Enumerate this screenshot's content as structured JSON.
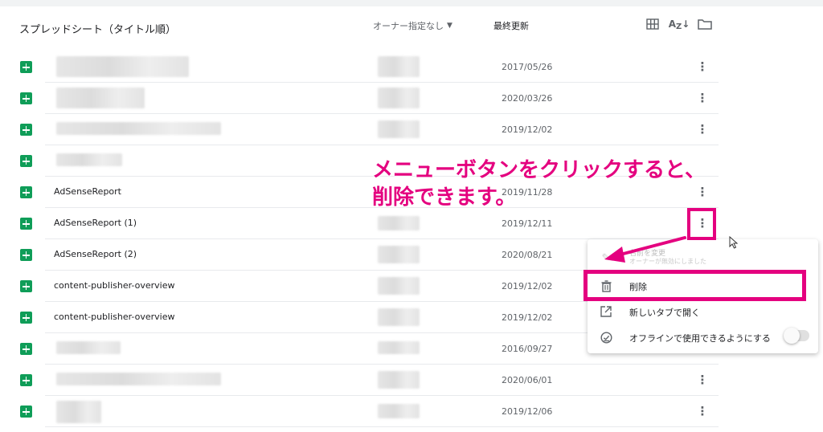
{
  "header": {
    "title": "スプレッドシート（タイトル順）",
    "owner_filter": "オーナー指定なし",
    "last_modified": "最終更新"
  },
  "icons": {
    "grid_view": "grid-icon",
    "sort": "sort-az-icon",
    "folder": "folder-icon"
  },
  "rows": [
    {
      "name": "",
      "date": "2017/05/26"
    },
    {
      "name": "",
      "date": "2020/03/26"
    },
    {
      "name": "",
      "date": "2019/12/02"
    },
    {
      "name": "",
      "date": ""
    },
    {
      "name": "AdSenseReport",
      "date": "2019/11/28"
    },
    {
      "name": "AdSenseReport (1)",
      "date": "2019/12/11"
    },
    {
      "name": "AdSenseReport (2)",
      "date": "2020/08/21"
    },
    {
      "name": "content-publisher-overview",
      "date": "2019/12/02"
    },
    {
      "name": "content-publisher-overview",
      "date": "2019/12/02"
    },
    {
      "name": "",
      "date": "2016/09/27"
    },
    {
      "name": "",
      "date": "2020/06/01"
    },
    {
      "name": "",
      "date": "2019/12/06"
    }
  ],
  "menu": {
    "rename_label": "名前を変更",
    "rename_sub": "オーナーが無効にしました",
    "delete_label": "削除",
    "open_new_tab_label": "新しいタブで開く",
    "offline_label": "オフラインで使用できるようにする",
    "offline_enabled": false
  },
  "annotation": {
    "line1": "メニューボタンをクリックすると、",
    "line2": "削除できます。"
  },
  "colors": {
    "accent": "#e4007f",
    "sheets_green": "#0f9d58"
  }
}
